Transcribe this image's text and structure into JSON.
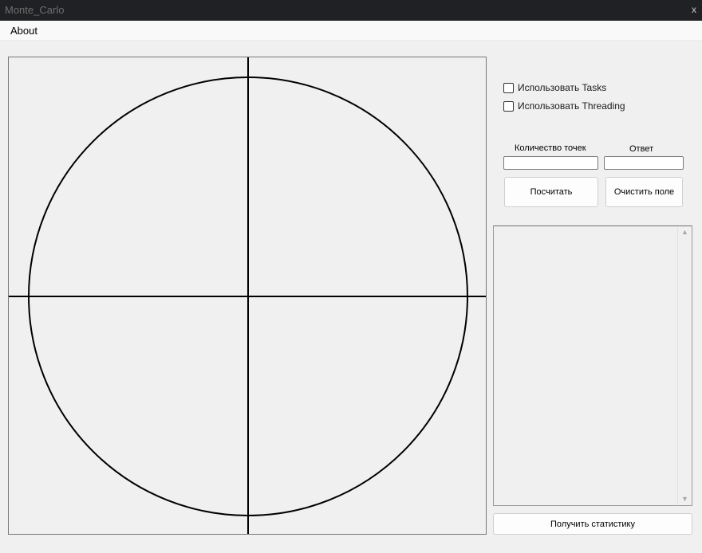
{
  "window": {
    "title": "Monte_Carlo",
    "close_glyph": "x"
  },
  "menu": {
    "items": [
      "About"
    ]
  },
  "options": {
    "use_tasks": {
      "label": "Использовать Tasks",
      "checked": false
    },
    "use_threading": {
      "label": "Использовать Threading",
      "checked": false
    }
  },
  "inputs": {
    "points_label": "Количество точек",
    "points_value": "",
    "answer_label": "Ответ",
    "answer_value": ""
  },
  "buttons": {
    "calculate": "Посчитать",
    "clear": "Очистить поле",
    "stats": "Получить статистику"
  },
  "log_list": {
    "items": []
  },
  "icons": {
    "scroll_up": "scroll-up-arrow-icon",
    "scroll_down": "scroll-down-arrow-icon"
  }
}
